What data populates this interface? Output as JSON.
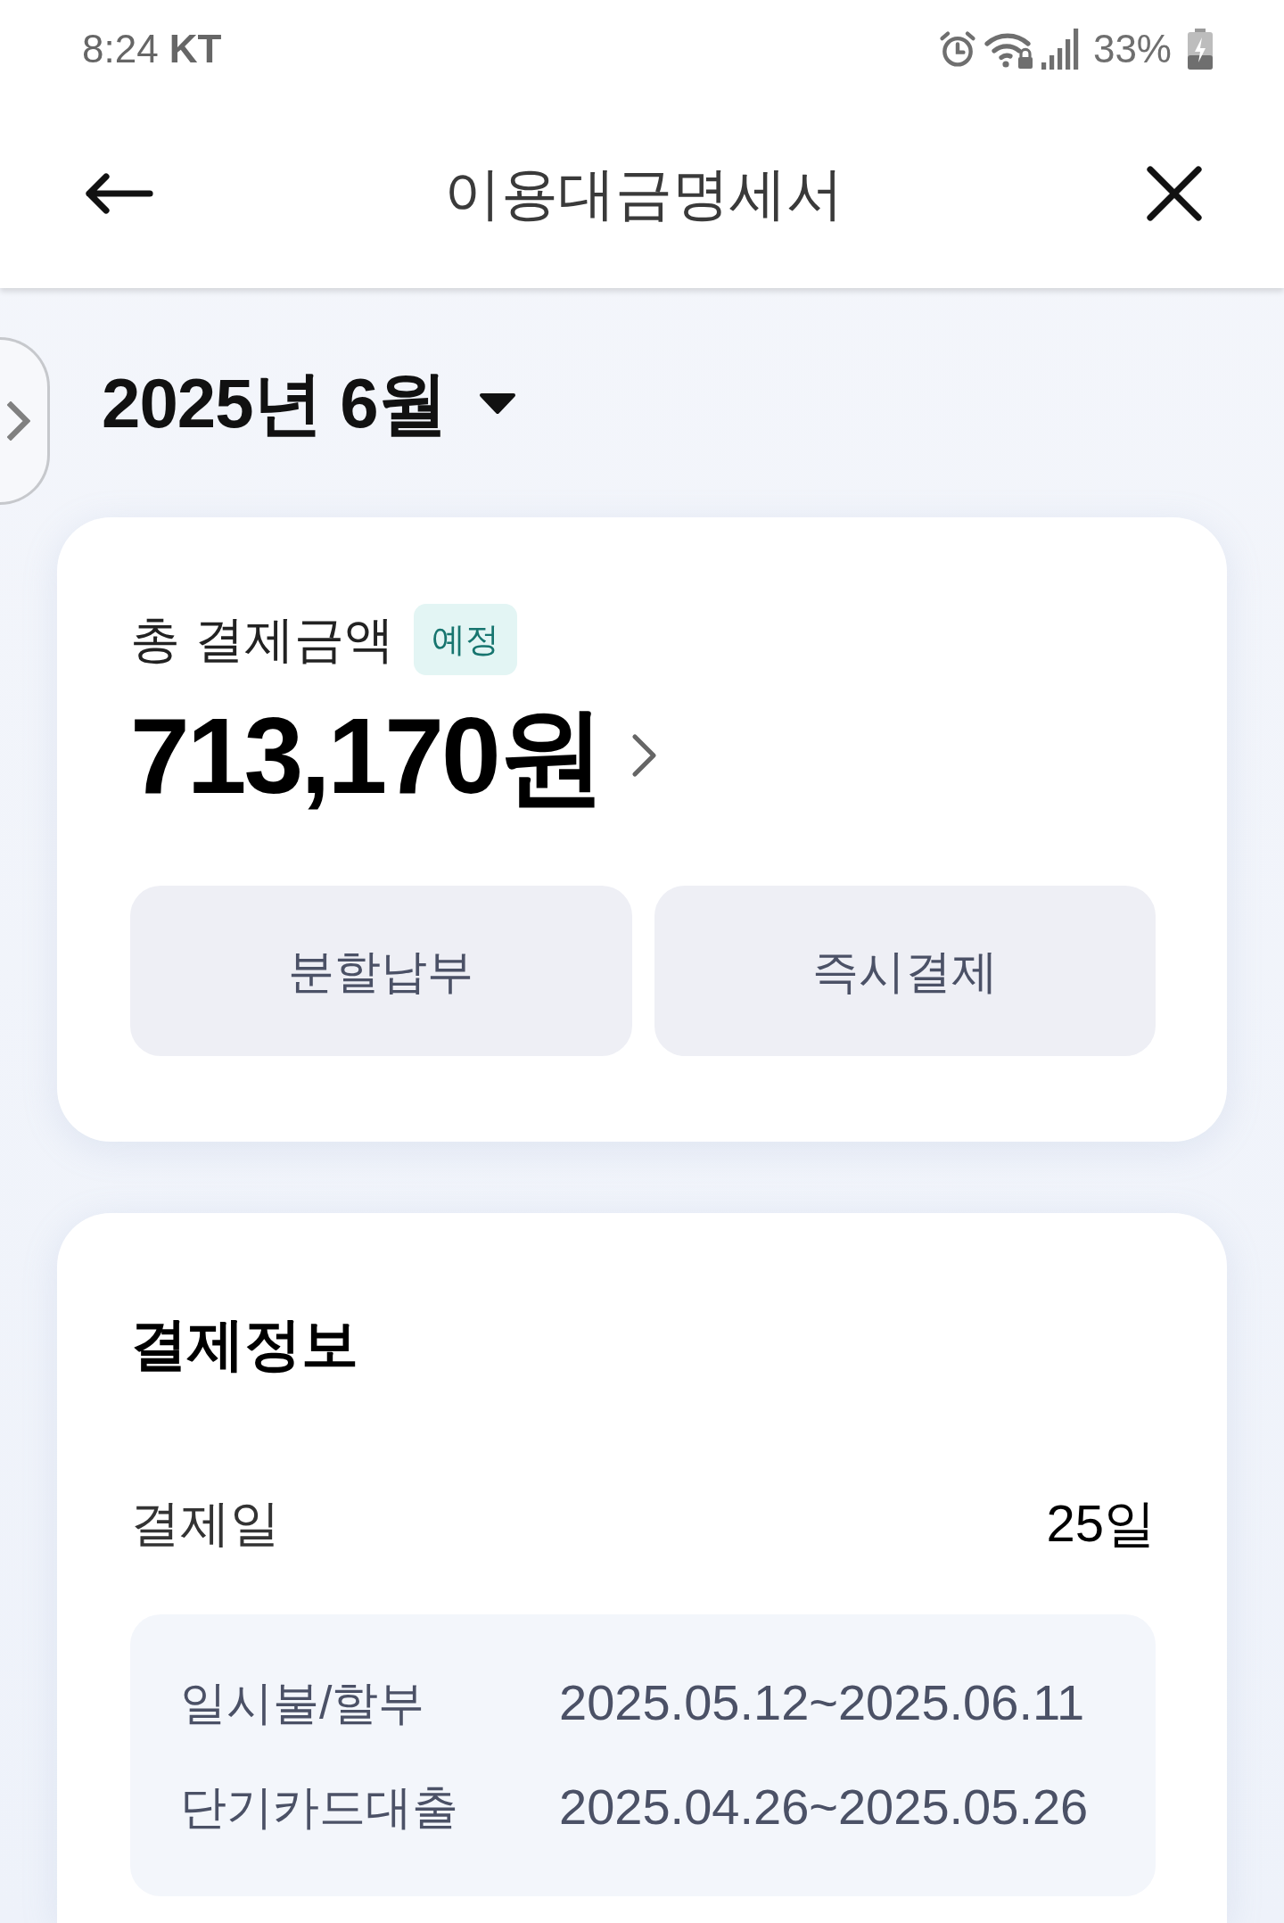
{
  "status_bar": {
    "time": "8:24",
    "carrier": "KT",
    "battery": "33%"
  },
  "header": {
    "title": "이용대금명세서"
  },
  "month_selector": {
    "label": "2025년 6월"
  },
  "summary_card": {
    "label": "총 결제금액",
    "badge": "예정",
    "amount": "713,170원",
    "buttons": [
      "분할납부",
      "즉시결제"
    ]
  },
  "payment_info": {
    "title": "결제정보",
    "rows": [
      {
        "label": "결제일",
        "value": "25일"
      }
    ],
    "periods": [
      {
        "label": "일시불/할부",
        "value": "2025.05.12~2025.06.11"
      },
      {
        "label": "단기카드대출",
        "value": "2025.04.26~2025.05.26"
      }
    ]
  }
}
